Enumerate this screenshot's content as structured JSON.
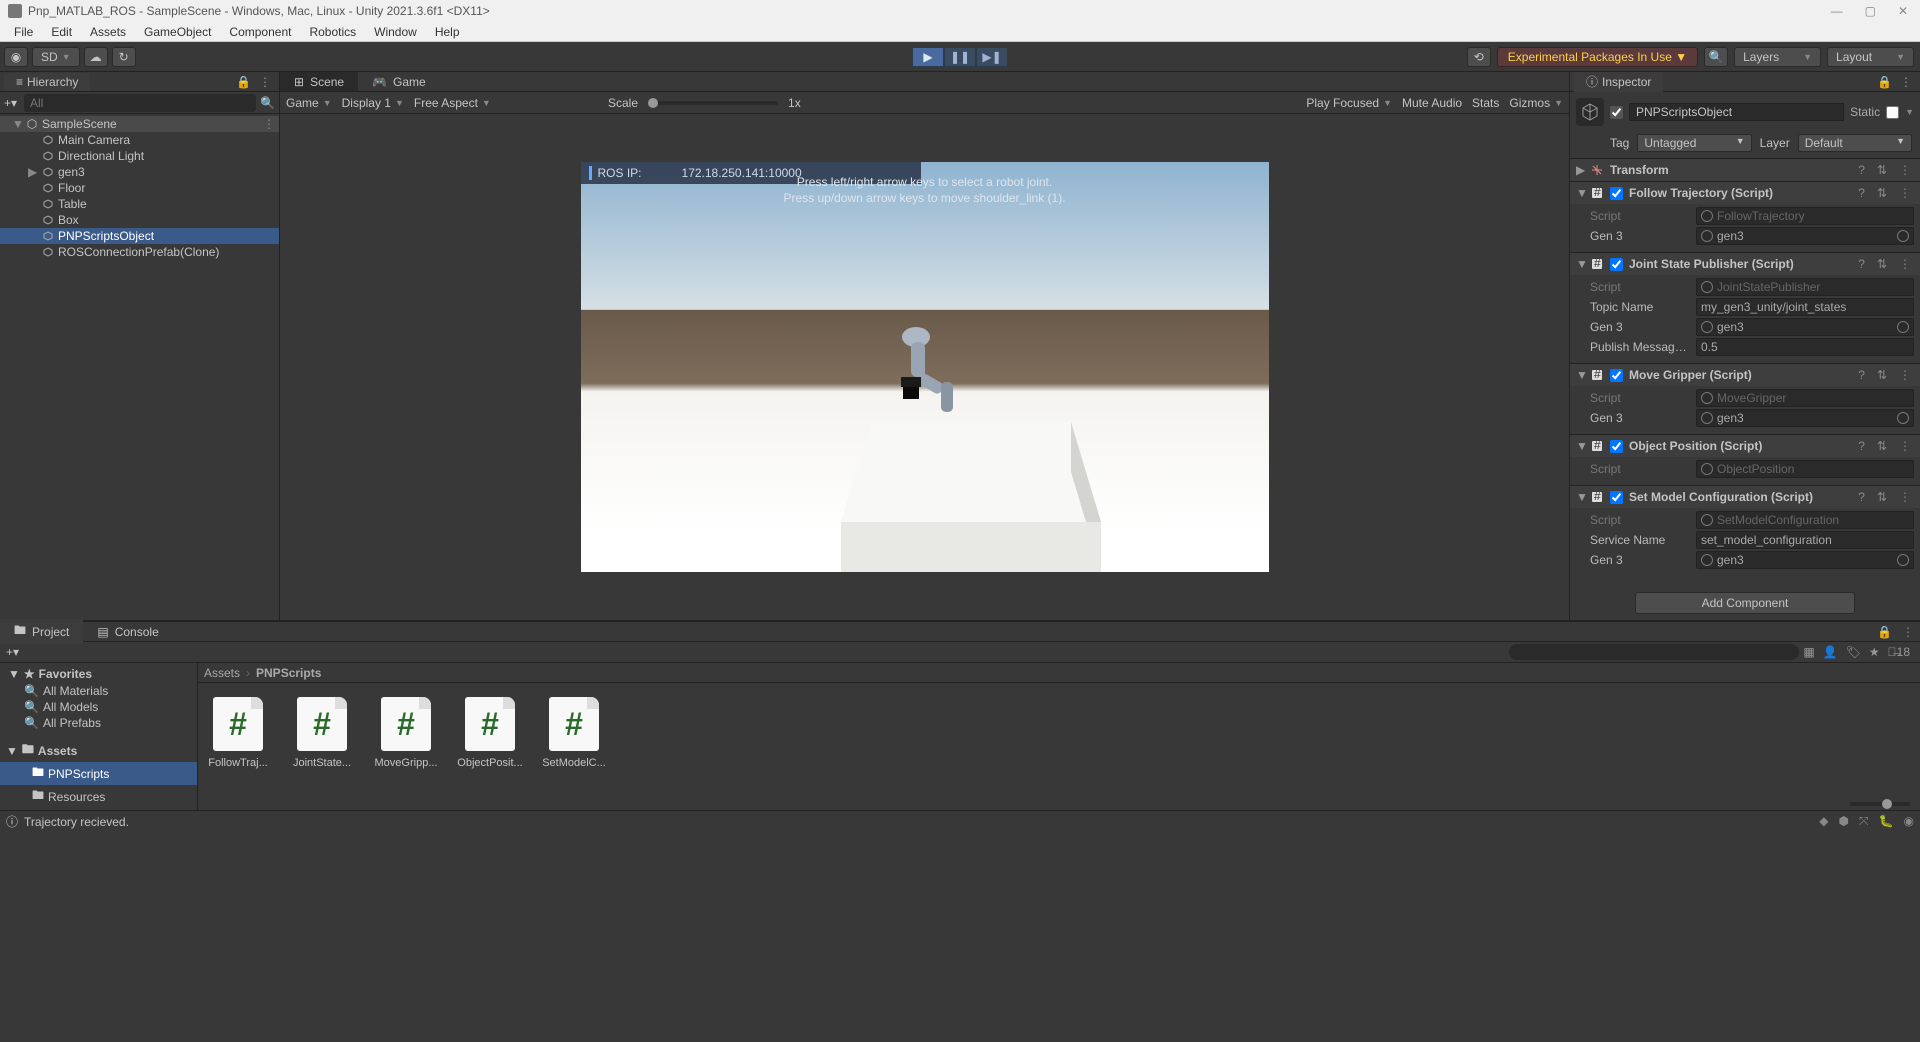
{
  "window": {
    "title": "Pnp_MATLAB_ROS - SampleScene - Windows, Mac, Linux - Unity 2021.3.6f1 <DX11>"
  },
  "menu": [
    "File",
    "Edit",
    "Assets",
    "GameObject",
    "Component",
    "Robotics",
    "Window",
    "Help"
  ],
  "toolbar": {
    "sd_label": "SD",
    "exp_warning": "Experimental Packages In Use ▼",
    "layers": "Layers",
    "layout": "Layout"
  },
  "hierarchy": {
    "title": "Hierarchy",
    "search_placeholder": "All",
    "scene": "SampleScene",
    "items": [
      "Main Camera",
      "Directional Light",
      "gen3",
      "Floor",
      "Table",
      "Box",
      "PNPScriptsObject",
      "ROSConnectionPrefab(Clone)"
    ],
    "selected": "PNPScriptsObject"
  },
  "view": {
    "scene_tab": "Scene",
    "game_tab": "Game",
    "game_dd": "Game",
    "display": "Display 1",
    "aspect": "Free Aspect",
    "scale_label": "Scale",
    "scale_value": "1x",
    "play_focused": "Play Focused",
    "mute": "Mute Audio",
    "stats": "Stats",
    "gizmos": "Gizmos"
  },
  "game_overlay": {
    "ros_label": "ROS IP:",
    "ros_ip": "172.18.250.141:10000",
    "hint1": "Press left/right arrow keys to select a robot joint.",
    "hint2": "Press up/down arrow keys to move shoulder_link (1)."
  },
  "inspector": {
    "title": "Inspector",
    "obj_name": "PNPScriptsObject",
    "static_label": "Static",
    "tag_label": "Tag",
    "tag_value": "Untagged",
    "layer_label": "Layer",
    "layer_value": "Default",
    "components": [
      {
        "name": "Transform",
        "collapsed": true,
        "icon": "transform"
      },
      {
        "name": "Follow Trajectory (Script)",
        "icon": "script",
        "checked": true,
        "props": [
          {
            "label": "Script",
            "value": "FollowTrajectory",
            "ref": true,
            "disabled": true
          },
          {
            "label": "Gen 3",
            "value": "gen3",
            "ref": true,
            "target": true
          }
        ]
      },
      {
        "name": "Joint State Publisher (Script)",
        "icon": "script",
        "checked": true,
        "props": [
          {
            "label": "Script",
            "value": "JointStatePublisher",
            "ref": true,
            "disabled": true
          },
          {
            "label": "Topic Name",
            "value": "my_gen3_unity/joint_states"
          },
          {
            "label": "Gen 3",
            "value": "gen3",
            "ref": true,
            "target": true
          },
          {
            "label": "Publish Message Frequency",
            "value": "0.5"
          }
        ]
      },
      {
        "name": "Move Gripper (Script)",
        "icon": "script",
        "checked": true,
        "props": [
          {
            "label": "Script",
            "value": "MoveGripper",
            "ref": true,
            "disabled": true
          },
          {
            "label": "Gen 3",
            "value": "gen3",
            "ref": true,
            "target": true
          }
        ]
      },
      {
        "name": "Object Position (Script)",
        "icon": "script",
        "checked": true,
        "props": [
          {
            "label": "Script",
            "value": "ObjectPosition",
            "ref": true,
            "disabled": true
          }
        ]
      },
      {
        "name": "Set Model Configuration (Script)",
        "icon": "script",
        "checked": true,
        "props": [
          {
            "label": "Script",
            "value": "SetModelConfiguration",
            "ref": true,
            "disabled": true
          },
          {
            "label": "Service Name",
            "value": "set_model_configuration"
          },
          {
            "label": "Gen 3",
            "value": "gen3",
            "ref": true,
            "target": true
          }
        ]
      }
    ],
    "add_component": "Add Component"
  },
  "project": {
    "project_tab": "Project",
    "console_tab": "Console",
    "hidden_count": "18",
    "favorites_label": "Favorites",
    "favorites": [
      "All Materials",
      "All Models",
      "All Prefabs"
    ],
    "assets_label": "Assets",
    "folders": [
      "PNPScripts",
      "Resources"
    ],
    "selected_folder": "PNPScripts",
    "breadcrumb": [
      "Assets",
      "PNPScripts"
    ],
    "assets": [
      "FollowTraj...",
      "JointState...",
      "MoveGripp...",
      "ObjectPosit...",
      "SetModelC..."
    ]
  },
  "status": {
    "message": "Trajectory recieved."
  }
}
